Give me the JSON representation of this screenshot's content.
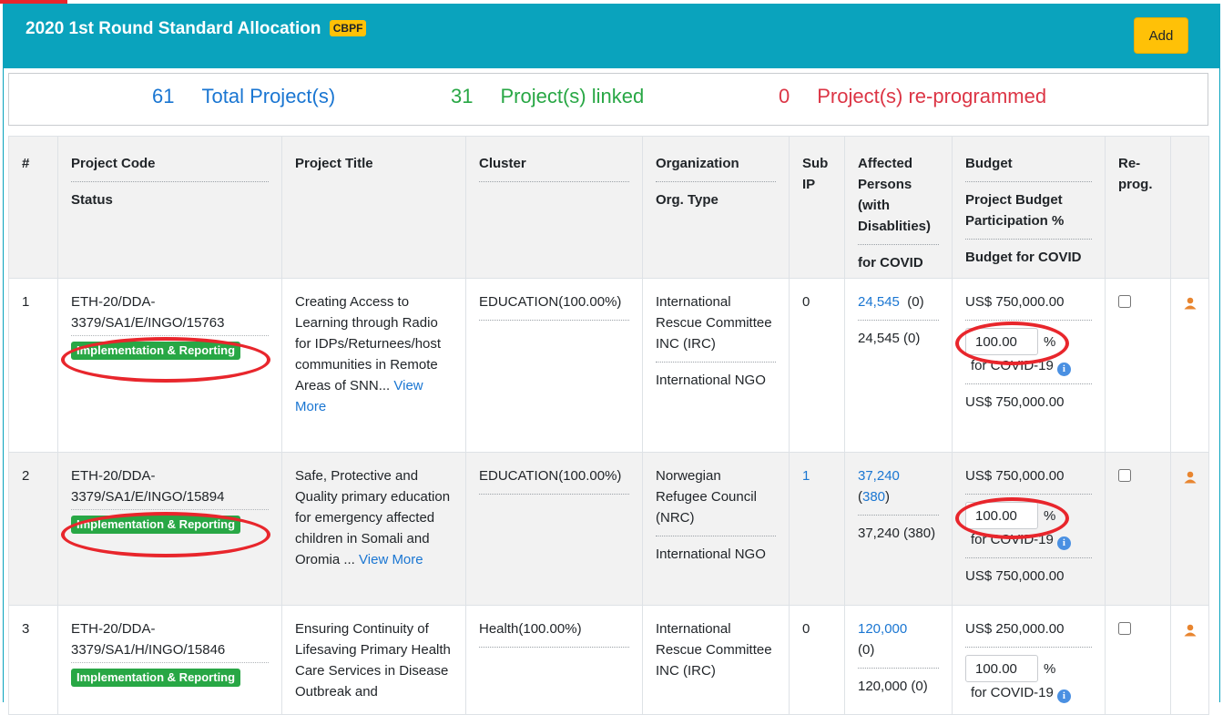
{
  "header": {
    "title": "2020 1st Round Standard Allocation",
    "badge": "CBPF",
    "add_label": "Add"
  },
  "summary": {
    "total_count": "61",
    "total_label": "Total Project(s)",
    "linked_count": "31",
    "linked_label": "Project(s) linked",
    "reprog_count": "0",
    "reprog_label": "Project(s) re-programmed"
  },
  "columns": {
    "num": "#",
    "code": "Project Code",
    "status": "Status",
    "title": "Project Title",
    "cluster": "Cluster",
    "org": "Organization",
    "org_type": "Org. Type",
    "sub_ip": "Sub IP",
    "affected": "Affected Persons (with Disablities)",
    "affected_covid": "for COVID",
    "budget": "Budget",
    "project_budget": "Project Budget",
    "participation": "Participation %",
    "budget_covid": "Budget for COVID",
    "reprog": "Re-prog."
  },
  "rows": [
    {
      "num": "1",
      "code": "ETH-20/DDA-3379/SA1/E/INGO/15763",
      "status": "Implementation & Reporting",
      "title": "Creating Access to Learning through Radio for IDPs/Returnees/host communities in Remote Areas of SNN...",
      "view_more": "View More",
      "cluster": "EDUCATION(100.00%)",
      "org": "International Rescue Committee INC (IRC)",
      "org_type": "International NGO",
      "sub_ip": "0",
      "affected": "24,545",
      "affected_dis": "(0)",
      "affected_covid": "24,545 (0)",
      "budget": "US$ 750,000.00",
      "pct": "100.00",
      "pct_sign": "%",
      "covid_label": "for COVID-19",
      "budget_covid": "US$ 750,000.00"
    },
    {
      "num": "2",
      "code": "ETH-20/DDA-3379/SA1/E/INGO/15894",
      "status": "Implementation & Reporting",
      "title": "Safe, Protective and Quality primary education for emergency affected children in Somali and Oromia ...",
      "view_more": "View More",
      "cluster": "EDUCATION(100.00%)",
      "org": "Norwegian Refugee Council (NRC)",
      "org_type": "International NGO",
      "sub_ip": "1",
      "affected": "37,240",
      "affected_dis": "380",
      "affected_covid": "37,240 (380)",
      "budget": "US$ 750,000.00",
      "pct": "100.00",
      "pct_sign": "%",
      "covid_label": "for COVID-19",
      "budget_covid": "US$ 750,000.00"
    },
    {
      "num": "3",
      "code": "ETH-20/DDA-3379/SA1/H/INGO/15846",
      "status": "Implementation & Reporting",
      "title": "Ensuring Continuity of Lifesaving Primary Health Care Services in Disease Outbreak and",
      "cluster": "Health(100.00%)",
      "org": "International Rescue Committee INC (IRC)",
      "sub_ip": "0",
      "affected": "120,000",
      "affected_dis": "(0)",
      "affected_covid": "120,000 (0)",
      "budget": "US$ 250,000.00",
      "pct": "100.00",
      "pct_sign": "%",
      "covid_label": "for COVID-19"
    }
  ],
  "colors": {
    "header_bg": "#0aa3bd",
    "accent_yellow": "#ffc107",
    "status_green": "#28a745",
    "link_blue": "#1a76d2",
    "alert_red": "#dc3545",
    "annotation_red": "#e8262c",
    "user_icon": "#e8852f"
  },
  "icons": {
    "info": "info-icon",
    "user": "user-icon"
  }
}
